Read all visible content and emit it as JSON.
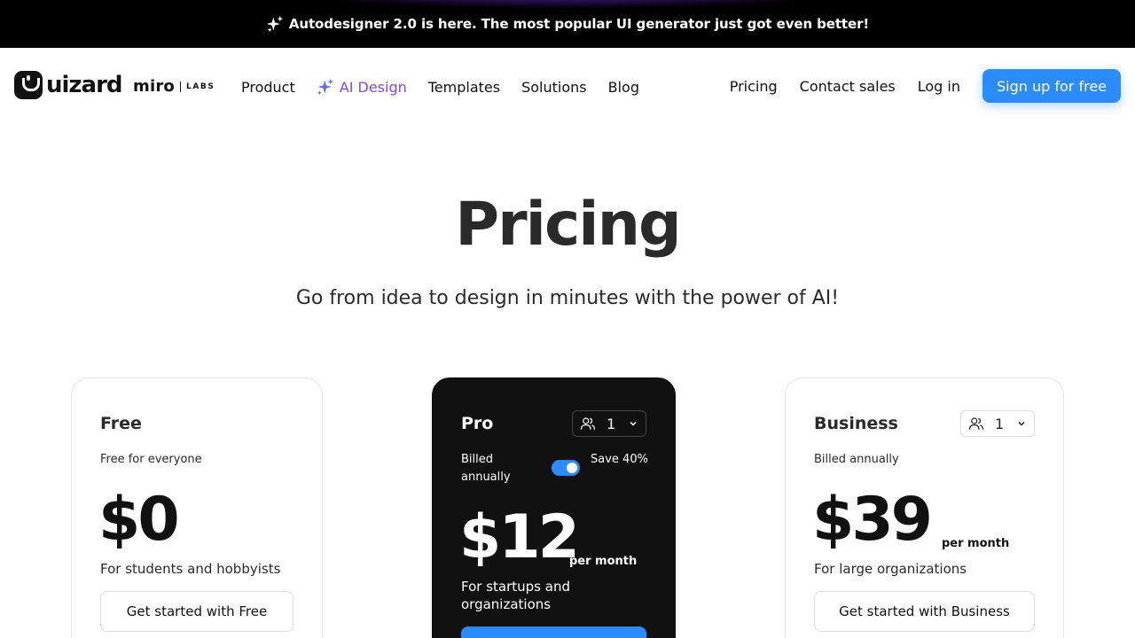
{
  "announcement": {
    "text": "Autodesigner 2.0 is here. The most popular UI generator just got even better!",
    "icon": "sparkles-icon"
  },
  "nav": {
    "logo_text": "uizard",
    "partner": "miro",
    "partner_suffix": "LABS",
    "links": [
      {
        "label": "Product"
      },
      {
        "label": "AI Design",
        "icon": "sparkles-icon"
      },
      {
        "label": "Templates"
      },
      {
        "label": "Solutions"
      },
      {
        "label": "Blog"
      }
    ],
    "right_links": [
      {
        "label": "Pricing"
      },
      {
        "label": "Contact sales"
      },
      {
        "label": "Log in"
      }
    ],
    "cta_label": "Sign up for free"
  },
  "hero": {
    "title": "Pricing",
    "subtitle": "Go from idea to design in minutes with the power of AI!"
  },
  "plans": [
    {
      "name": "Free",
      "description": "Free for everyone",
      "price": "$0",
      "audience": "For students and hobbyists",
      "cta": "Get started with Free"
    },
    {
      "name": "Pro",
      "seats": "1",
      "billed_label": "Billed annually",
      "toggle_on": true,
      "save_label": "Save 40%",
      "price": "$12",
      "period": "per month",
      "audience": "For startups and organizations",
      "cta": ""
    },
    {
      "name": "Business",
      "seats": "1",
      "description": "Billed annually",
      "price": "$39",
      "period": "per month",
      "audience": "For large organizations",
      "cta": "Get started with Business"
    }
  ],
  "colors": {
    "accent": "#2b8cff",
    "ai_purple": "#7b4bf0",
    "announcement_bg": "#000000",
    "pro_card_bg": "#111111"
  }
}
